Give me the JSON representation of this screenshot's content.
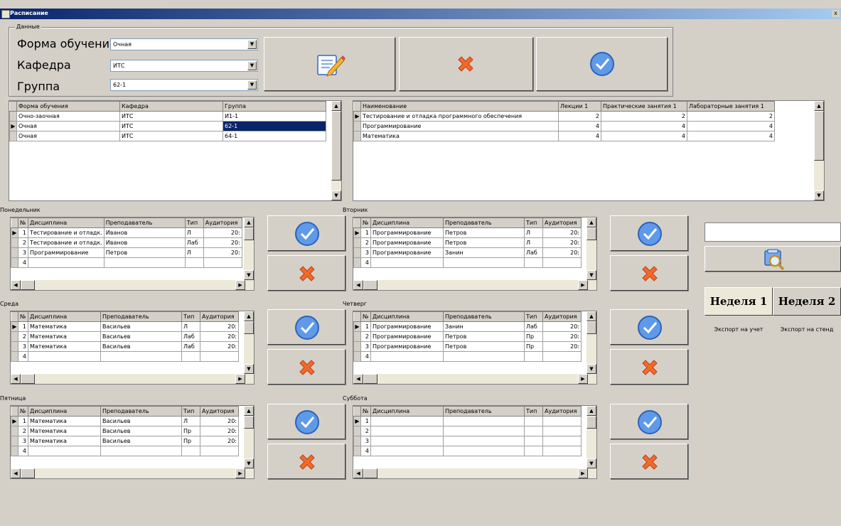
{
  "window": {
    "title": "Расписание",
    "close_label": "x"
  },
  "data_group": {
    "legend": "Данные",
    "form_label": "Форма обучения",
    "form_value": "Очная",
    "dept_label": "Кафедра",
    "dept_value": "ИТС",
    "group_label": "Группа",
    "group_value": "62-1"
  },
  "groups_grid": {
    "headers": [
      "Форма обучения",
      "Кафедра",
      "Группа"
    ],
    "rows": [
      [
        "Очно-заочная",
        "ИТС",
        "И1-1"
      ],
      [
        "Очная",
        "ИТС",
        "62-1"
      ],
      [
        "Очная",
        "ИТС",
        "64-1"
      ]
    ]
  },
  "subjects_grid": {
    "headers": [
      "Наименование",
      "Лекции 1",
      "Практические занятия 1",
      "Лабораторные занятия 1"
    ],
    "rows": [
      [
        "Тестирование и отладка программного обеспечения",
        "2",
        "2",
        "2"
      ],
      [
        "Программирование",
        "4",
        "4",
        "4"
      ],
      [
        "Математика",
        "4",
        "4",
        "4"
      ]
    ]
  },
  "schedule_headers": [
    "№",
    "Дисциплина",
    "Преподаватель",
    "Тип",
    "Аудитория"
  ],
  "days": {
    "mon": {
      "label": "Понедельник",
      "rows": [
        [
          "1",
          "Тестирование и отладк.",
          "Иванов",
          "Л",
          "20:"
        ],
        [
          "2",
          "Тестирование и отладк.",
          "Иванов",
          "Лаб",
          "20:"
        ],
        [
          "3",
          "Программирование",
          "Петров",
          "Л",
          "20:"
        ],
        [
          "4",
          "",
          "",
          "",
          ""
        ]
      ]
    },
    "tue": {
      "label": "Вторник",
      "rows": [
        [
          "1",
          "Программирование",
          "Петров",
          "Л",
          "20:"
        ],
        [
          "2",
          "Программирование",
          "Петров",
          "Л",
          "20:"
        ],
        [
          "3",
          "Программирование",
          "Занин",
          "Лаб",
          "20:"
        ],
        [
          "4",
          "",
          "",
          "",
          ""
        ]
      ]
    },
    "wed": {
      "label": "Среда",
      "rows": [
        [
          "1",
          "Математика",
          "Васильев",
          "Л",
          "20:"
        ],
        [
          "2",
          "Математика",
          "Васильев",
          "Лаб",
          "20:"
        ],
        [
          "3",
          "Математика",
          "Васильев",
          "Лаб",
          "20:"
        ],
        [
          "4",
          "",
          "",
          "",
          ""
        ]
      ]
    },
    "thu": {
      "label": "Четверг",
      "rows": [
        [
          "1",
          "Программирование",
          "Занин",
          "Лаб",
          "20:"
        ],
        [
          "2",
          "Программирование",
          "Петров",
          "Пр",
          "20:"
        ],
        [
          "3",
          "Программирование",
          "Петров",
          "Пр",
          "20:"
        ],
        [
          "4",
          "",
          "",
          "",
          ""
        ]
      ]
    },
    "fri": {
      "label": "Пятница",
      "rows": [
        [
          "1",
          "Математика",
          "Васильев",
          "Л",
          "20:"
        ],
        [
          "2",
          "Математика",
          "Васильев",
          "Пр",
          "20:"
        ],
        [
          "3",
          "Математика",
          "Васильев",
          "Пр",
          "20:"
        ],
        [
          "4",
          "",
          "",
          "",
          ""
        ]
      ]
    },
    "sat": {
      "label": "Суббота",
      "rows": [
        [
          "1",
          "",
          "",
          "",
          ""
        ],
        [
          "2",
          "",
          "",
          "",
          ""
        ],
        [
          "3",
          "",
          "",
          "",
          ""
        ],
        [
          "4",
          "",
          "",
          "",
          ""
        ]
      ]
    }
  },
  "side": {
    "week1": "Неделя 1",
    "week2": "Неделя 2",
    "export_account": "Экспорт на учет",
    "export_stand": "Экспорт на стенд"
  },
  "icons": {
    "edit": "edit-icon",
    "delete": "delete-icon",
    "confirm": "check-icon",
    "search": "search-icon"
  },
  "colors": {
    "window_bg": "#d4d0c8",
    "title_start": "#0a246a",
    "title_end": "#a6caf0",
    "selection": "#0a246a"
  }
}
